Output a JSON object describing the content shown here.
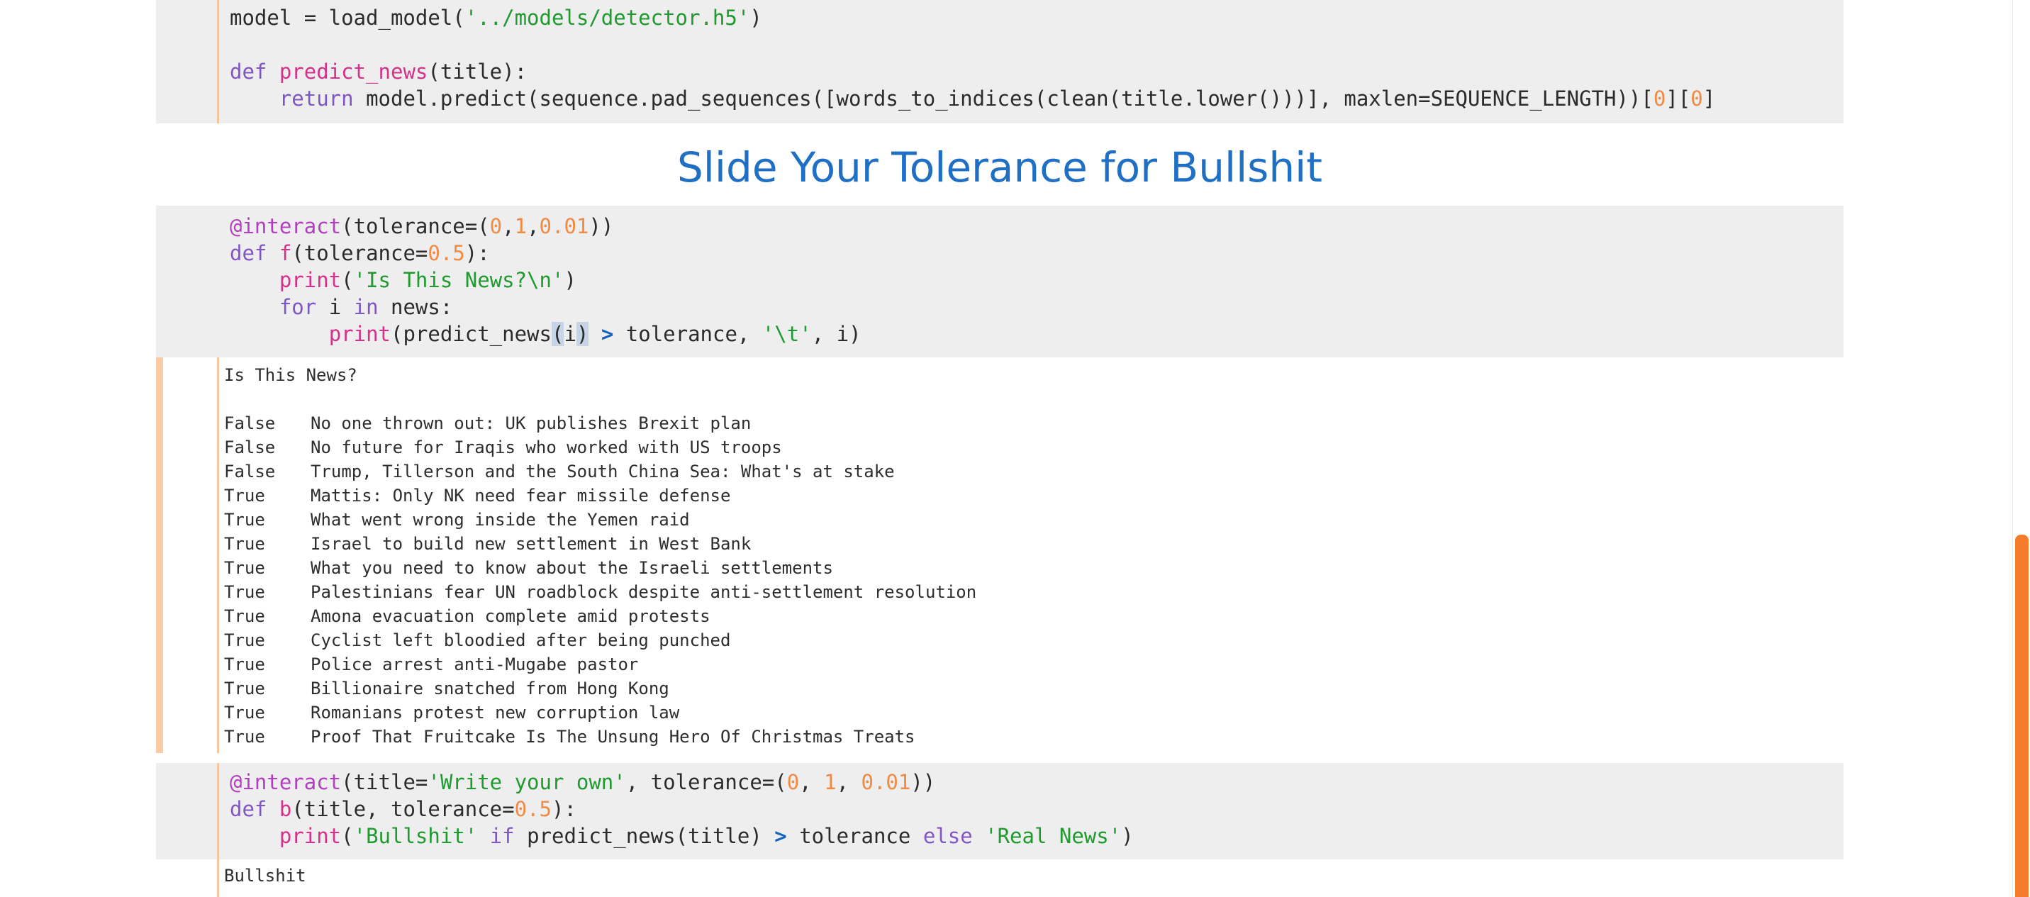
{
  "cell1": {
    "lines": [
      [
        {
          "t": "model = load_model(",
          "c": ""
        },
        {
          "t": "'../models/detector.h5'",
          "c": "str"
        },
        {
          "t": ")",
          "c": ""
        }
      ],
      [],
      [
        {
          "t": "def ",
          "c": "kw"
        },
        {
          "t": "predict_news",
          "c": "fn"
        },
        {
          "t": "(title):",
          "c": ""
        }
      ],
      [
        {
          "t": "    ",
          "c": ""
        },
        {
          "t": "return",
          "c": "kw"
        },
        {
          "t": " model.predict(sequence.pad_sequences([words_to_indices(clean(title.lower()))], maxlen=SEQUENCE_LENGTH))[",
          "c": ""
        },
        {
          "t": "0",
          "c": "num"
        },
        {
          "t": "][",
          "c": ""
        },
        {
          "t": "0",
          "c": "num"
        },
        {
          "t": "]",
          "c": ""
        }
      ]
    ]
  },
  "heading": "Slide Your Tolerance for Bullshit",
  "cell2": {
    "lines": [
      [
        {
          "t": "@interact",
          "c": "dec"
        },
        {
          "t": "(tolerance=(",
          "c": ""
        },
        {
          "t": "0",
          "c": "num"
        },
        {
          "t": ",",
          "c": ""
        },
        {
          "t": "1",
          "c": "num"
        },
        {
          "t": ",",
          "c": ""
        },
        {
          "t": "0.01",
          "c": "num"
        },
        {
          "t": "))",
          "c": ""
        }
      ],
      [
        {
          "t": "def ",
          "c": "kw"
        },
        {
          "t": "f",
          "c": "fn"
        },
        {
          "t": "(tolerance=",
          "c": ""
        },
        {
          "t": "0.5",
          "c": "num"
        },
        {
          "t": "):",
          "c": ""
        }
      ],
      [
        {
          "t": "    ",
          "c": ""
        },
        {
          "t": "print",
          "c": "bi"
        },
        {
          "t": "(",
          "c": ""
        },
        {
          "t": "'Is This News?\\n'",
          "c": "str"
        },
        {
          "t": ")",
          "c": ""
        }
      ],
      [
        {
          "t": "    ",
          "c": ""
        },
        {
          "t": "for",
          "c": "kw"
        },
        {
          "t": " i ",
          "c": ""
        },
        {
          "t": "in",
          "c": "kw"
        },
        {
          "t": " news:",
          "c": ""
        }
      ],
      [
        {
          "t": "        ",
          "c": ""
        },
        {
          "t": "print",
          "c": "bi"
        },
        {
          "t": "(predict_news",
          "c": ""
        },
        {
          "t": "(",
          "c": "hl"
        },
        {
          "t": "i",
          "c": ""
        },
        {
          "t": ")",
          "c": "hl"
        },
        {
          "t": " ",
          "c": ""
        },
        {
          "t": ">",
          "c": "op"
        },
        {
          "t": " tolerance, ",
          "c": ""
        },
        {
          "t": "'\\t'",
          "c": "str"
        },
        {
          "t": ", i)",
          "c": ""
        }
      ]
    ],
    "output_header": "Is This News?",
    "output_rows": [
      {
        "result": "False",
        "title": "No one thrown out: UK publishes Brexit plan"
      },
      {
        "result": "False",
        "title": "No future for Iraqis who worked with US troops"
      },
      {
        "result": "False",
        "title": "Trump, Tillerson and the South China Sea: What's at stake"
      },
      {
        "result": "True",
        "title": "Mattis: Only NK need fear missile defense"
      },
      {
        "result": "True",
        "title": "What went wrong inside the Yemen raid"
      },
      {
        "result": "True",
        "title": "Israel to build new settlement in West Bank"
      },
      {
        "result": "True",
        "title": "What you need to know about the Israeli settlements"
      },
      {
        "result": "True",
        "title": "Palestinians fear UN roadblock despite anti-settlement resolution"
      },
      {
        "result": "True",
        "title": "Amona evacuation complete amid protests"
      },
      {
        "result": "True",
        "title": "Cyclist left bloodied after being punched"
      },
      {
        "result": "True",
        "title": "Police arrest anti-Mugabe pastor"
      },
      {
        "result": "True",
        "title": "Billionaire snatched from Hong Kong"
      },
      {
        "result": "True",
        "title": "Romanians protest new corruption law"
      },
      {
        "result": "True",
        "title": "Proof That Fruitcake Is The Unsung Hero Of Christmas Treats"
      }
    ]
  },
  "cell3": {
    "lines": [
      [
        {
          "t": "@interact",
          "c": "dec"
        },
        {
          "t": "(title=",
          "c": ""
        },
        {
          "t": "'Write your own'",
          "c": "str"
        },
        {
          "t": ", tolerance=(",
          "c": ""
        },
        {
          "t": "0",
          "c": "num"
        },
        {
          "t": ", ",
          "c": ""
        },
        {
          "t": "1",
          "c": "num"
        },
        {
          "t": ", ",
          "c": ""
        },
        {
          "t": "0.01",
          "c": "num"
        },
        {
          "t": "))",
          "c": ""
        }
      ],
      [
        {
          "t": "def ",
          "c": "kw"
        },
        {
          "t": "b",
          "c": "fn"
        },
        {
          "t": "(title, tolerance=",
          "c": ""
        },
        {
          "t": "0.5",
          "c": "num"
        },
        {
          "t": "):",
          "c": ""
        }
      ],
      [
        {
          "t": "    ",
          "c": ""
        },
        {
          "t": "print",
          "c": "bi"
        },
        {
          "t": "(",
          "c": ""
        },
        {
          "t": "'Bullshit'",
          "c": "str"
        },
        {
          "t": " ",
          "c": ""
        },
        {
          "t": "if",
          "c": "kw"
        },
        {
          "t": " predict_news(title) ",
          "c": ""
        },
        {
          "t": ">",
          "c": "op"
        },
        {
          "t": " tolerance ",
          "c": ""
        },
        {
          "t": "else",
          "c": "kw"
        },
        {
          "t": " ",
          "c": ""
        },
        {
          "t": "'Real News'",
          "c": "str"
        },
        {
          "t": ")",
          "c": ""
        }
      ]
    ],
    "output": "Bullshit"
  },
  "scrollbar": {
    "thumb_color": "#f57c2a"
  },
  "colors": {
    "heading": "#1f6fc5",
    "string": "#1f9a2e",
    "keyword": "#7e57c2",
    "function": "#d6308a",
    "number": "#f08a44",
    "selected_cell_bar": "#fbcba3"
  }
}
